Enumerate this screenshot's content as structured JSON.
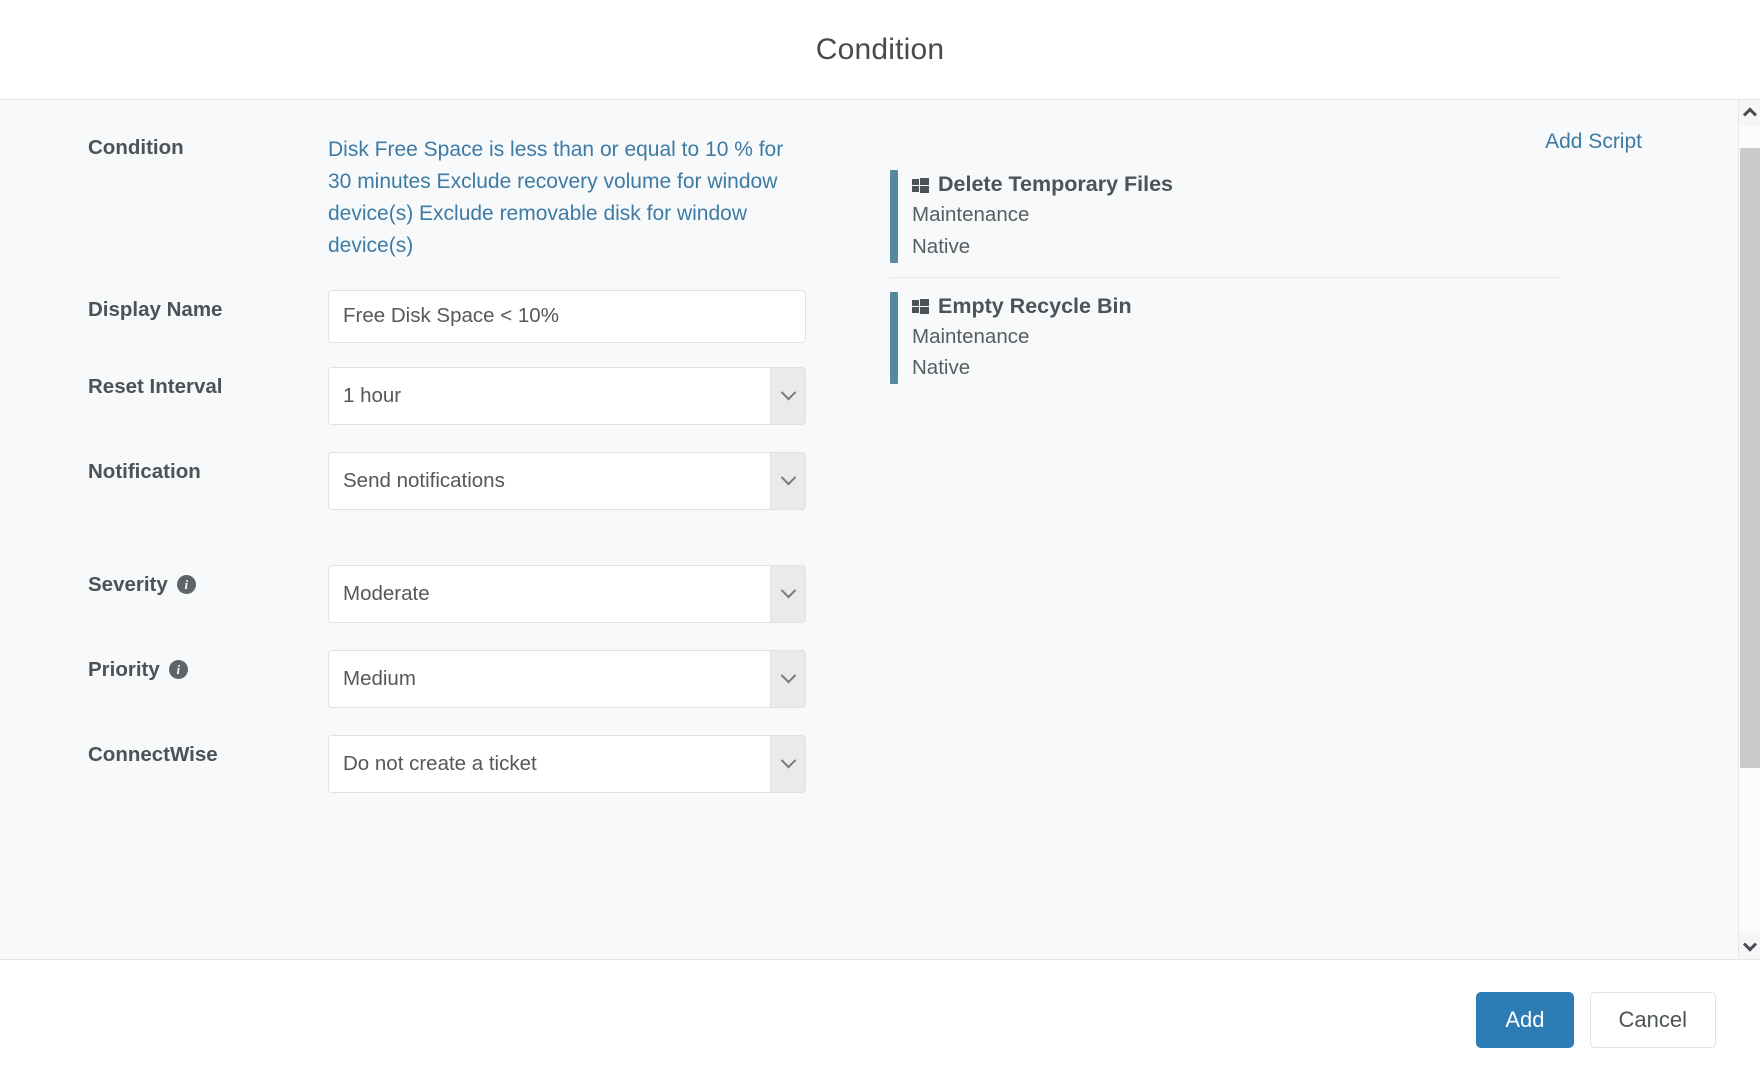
{
  "dialog": {
    "title": "Condition"
  },
  "form": {
    "condition": {
      "label": "Condition",
      "text": "Disk Free Space is less than or equal to 10 % for 30 minutes Exclude recovery volume for window device(s) Exclude removable disk for window device(s)"
    },
    "display_name": {
      "label": "Display Name",
      "value": "Free Disk Space < 10%",
      "placeholder": "Display Name"
    },
    "reset_interval": {
      "label": "Reset Interval",
      "value": "1 hour"
    },
    "notification": {
      "label": "Notification",
      "value": "Send notifications"
    },
    "severity": {
      "label": "Severity",
      "value": "Moderate",
      "info": "i"
    },
    "priority": {
      "label": "Priority",
      "value": "Medium",
      "info": "i"
    },
    "connectwise": {
      "label": "ConnectWise",
      "value": "Do not create a ticket"
    }
  },
  "scripts_panel": {
    "add_script_label": "Add Script",
    "items": [
      {
        "name": "Delete Temporary Files",
        "category": "Maintenance",
        "type": "Native",
        "platform_icon": "windows-icon"
      },
      {
        "name": "Empty Recycle Bin",
        "category": "Maintenance",
        "type": "Native",
        "platform_icon": "windows-icon"
      }
    ]
  },
  "footer": {
    "add_label": "Add",
    "cancel_label": "Cancel"
  },
  "colors": {
    "accent_blue": "#2e7cb5",
    "link_blue": "#3d7ba4",
    "script_accent": "#56899e",
    "body_bg": "#f7f9fa"
  }
}
